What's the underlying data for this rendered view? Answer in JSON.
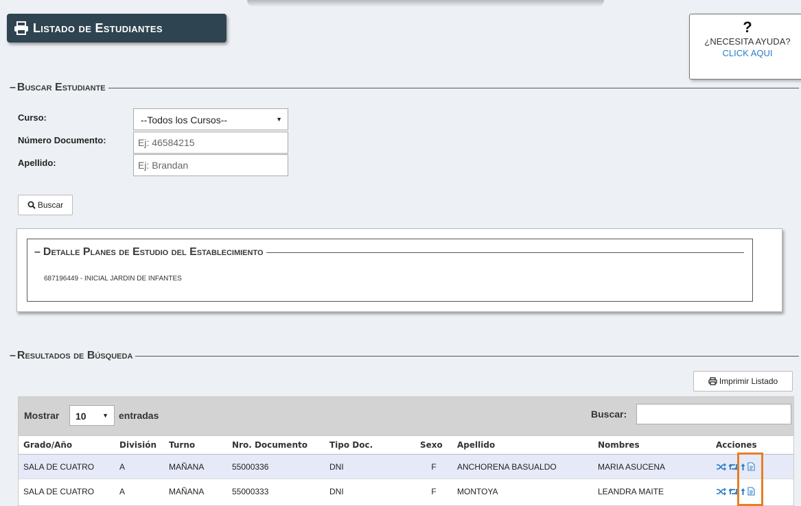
{
  "header": {
    "title": "Listado de Estudiantes",
    "help_question_mark": "?",
    "help_text": "¿NECESITA AYUDA?",
    "help_link": "CLICK AQUI"
  },
  "search": {
    "section_title": "Buscar Estudiante",
    "curso_label": "Curso:",
    "curso_value": "--Todos los Cursos--",
    "documento_label": "Número Documento:",
    "documento_placeholder": "Ej: 46584215",
    "apellido_label": "Apellido:",
    "apellido_placeholder": "Ej: Brandan",
    "buscar_button": "Buscar"
  },
  "plans": {
    "title": "Detalle Planes de Estudio del Establecimiento",
    "text": "687196449 - INICIAL JARDIN DE INFANTES"
  },
  "results": {
    "section_title": "Resultados de Búsqueda",
    "print_button": "Imprimir Listado",
    "show_label": "Mostrar",
    "show_value": "10",
    "entries_label": "entradas",
    "search_label": "Buscar:",
    "columns": [
      "Grado/Año",
      "División",
      "Turno",
      "Nro. Documento",
      "Tipo Doc.",
      "Sexo",
      "Apellido",
      "Nombres",
      "Acciones"
    ],
    "rows": [
      {
        "grado": "SALA DE CUATRO",
        "division": "A",
        "turno": "MAÑANA",
        "documento": "55000336",
        "tipo": "DNI",
        "sexo": "F",
        "apellido": "ANCHORENA BASUALDO",
        "nombres": "MARIA ASUCENA"
      },
      {
        "grado": "SALA DE CUATRO",
        "division": "A",
        "turno": "MAÑANA",
        "documento": "55000333",
        "tipo": "DNI",
        "sexo": "F",
        "apellido": "MONTOYA",
        "nombres": "LEANDRA MAITE"
      }
    ]
  },
  "icons": {
    "print": "printer-icon",
    "search": "search-icon",
    "shuffle": "shuffle-icon",
    "retweet": "retweet-icon",
    "upload": "arrow-up-icon",
    "document": "document-icon"
  },
  "colors": {
    "title_bg": "#2f4451",
    "link": "#2a7cc7",
    "row_highlight": "#e6e9f7",
    "action_icon": "#2a7cc7",
    "highlight_box": "#e67e22"
  }
}
